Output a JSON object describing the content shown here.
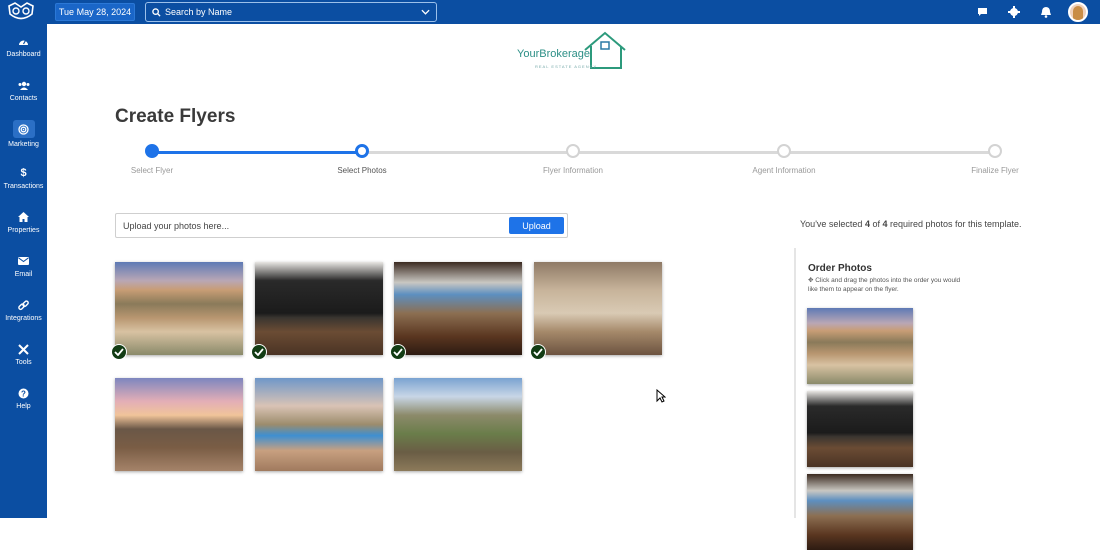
{
  "topbar": {
    "date": "Tue May 28, 2024",
    "search_placeholder": "Search by Name",
    "icons": [
      "chat-icon",
      "gear-icon",
      "bell-icon"
    ]
  },
  "sidebar": {
    "items": [
      {
        "label": "Dashboard",
        "icon": "dashboard-icon"
      },
      {
        "label": "Contacts",
        "icon": "users-icon"
      },
      {
        "label": "Marketing",
        "icon": "target-icon",
        "active": true
      },
      {
        "label": "Transactions",
        "icon": "dollar-icon"
      },
      {
        "label": "Properties",
        "icon": "home-icon"
      },
      {
        "label": "Email",
        "icon": "envelope-icon"
      },
      {
        "label": "Integrations",
        "icon": "link-icon"
      },
      {
        "label": "Tools",
        "icon": "tools-icon"
      },
      {
        "label": "Help",
        "icon": "question-icon"
      }
    ]
  },
  "brand": {
    "name": "YourBrokerage",
    "tagline": "REAL ESTATE AGENCY"
  },
  "page": {
    "title": "Create Flyers"
  },
  "stepper": {
    "current": 2,
    "steps": [
      "Select Flyer",
      "Select Photos",
      "Flyer Information",
      "Agent Information",
      "Finalize Flyer"
    ]
  },
  "upload": {
    "placeholder": "Upload your photos here...",
    "button": "Upload"
  },
  "selection": {
    "prefix": "You've selected ",
    "selected": "4",
    "middle": " of ",
    "required": "4",
    "suffix": " required photos for this template."
  },
  "photos": [
    {
      "scene": "desert",
      "selected": true
    },
    {
      "scene": "kitchen",
      "selected": true
    },
    {
      "scene": "living",
      "selected": true
    },
    {
      "scene": "bedroom",
      "selected": true
    },
    {
      "scene": "patio",
      "selected": false
    },
    {
      "scene": "pool",
      "selected": false
    },
    {
      "scene": "golf",
      "selected": false
    }
  ],
  "order": {
    "title": "Order Photos",
    "description": "Click and drag the photos into the order you would like them to appear on the flyer.",
    "thumbs": [
      "desert",
      "kitchen",
      "living"
    ]
  },
  "colors": {
    "primary": "#0b4ea2",
    "accent": "#1e73e8",
    "check": "#123c14"
  }
}
